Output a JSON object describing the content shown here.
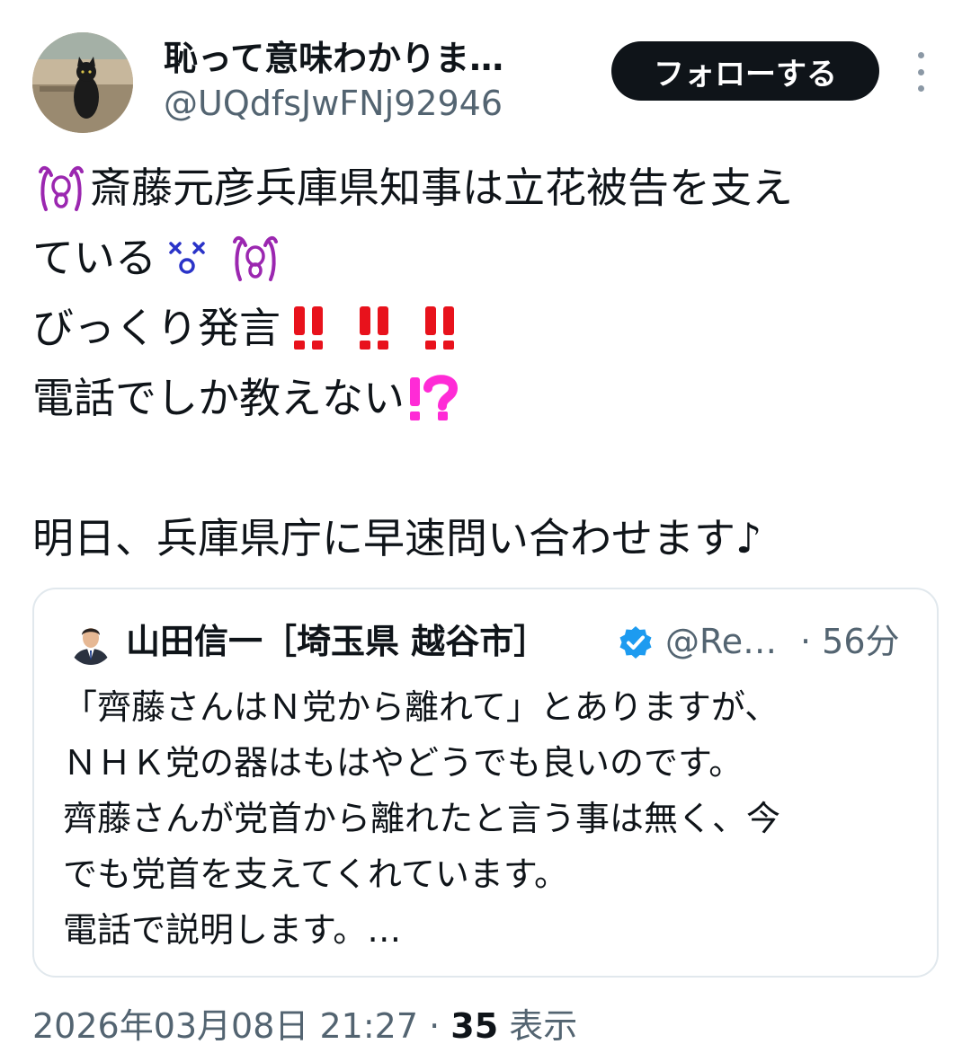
{
  "author": {
    "display_name": "恥って意味わかりま…",
    "handle": "@UQdfsJwFNj92946",
    "avatar_icon": "black-cat-photo-avatar"
  },
  "actions": {
    "follow_label": "フォローする",
    "more_icon": "more-vertical-icon"
  },
  "tweet": {
    "line1": "斎藤元彦兵庫県知事は立花被告を支え",
    "line2": "ている",
    "line3": "びっくり発言",
    "line4": "電話でしか教えない",
    "line6": "明日、兵庫県庁に早速問い合わせます♪",
    "emojis": {
      "line1_start": "scream-face-emoji",
      "line2_a": "dizzy-face-emoji",
      "line2_b": "scream-face-emoji",
      "line3": [
        "double-exclamation-emoji",
        "double-exclamation-emoji",
        "double-exclamation-emoji"
      ],
      "line4": "exclamation-question-emoji"
    }
  },
  "quote": {
    "display_name": "山田信一［埼玉県 越谷市］",
    "handle": "@Re…",
    "time": "· 56分",
    "verified": true,
    "avatar_icon": "man-in-suit-avatar",
    "lines": [
      "「齊藤さんはＮ党から離れて」とありますが、",
      "ＮＨＫ党の器はもはやどうでも良いのです。",
      "齊藤さんが党首から離れたと言う事は無く、今",
      "でも党首を支えてくれています。",
      "電話で説明します。…"
    ]
  },
  "meta": {
    "timestamp": "2026年03月08日 21:27",
    "separator": "·",
    "views_count": "35",
    "views_label": "表示"
  },
  "colors": {
    "primary_text": "#0f1419",
    "secondary_text": "#536471",
    "follow_bg": "#0f1419",
    "verified_blue": "#1d9bf0",
    "exclamation_red": "#e8121c",
    "interrobang_magenta": "#ff2bd6",
    "card_border": "#e1e8ed"
  }
}
